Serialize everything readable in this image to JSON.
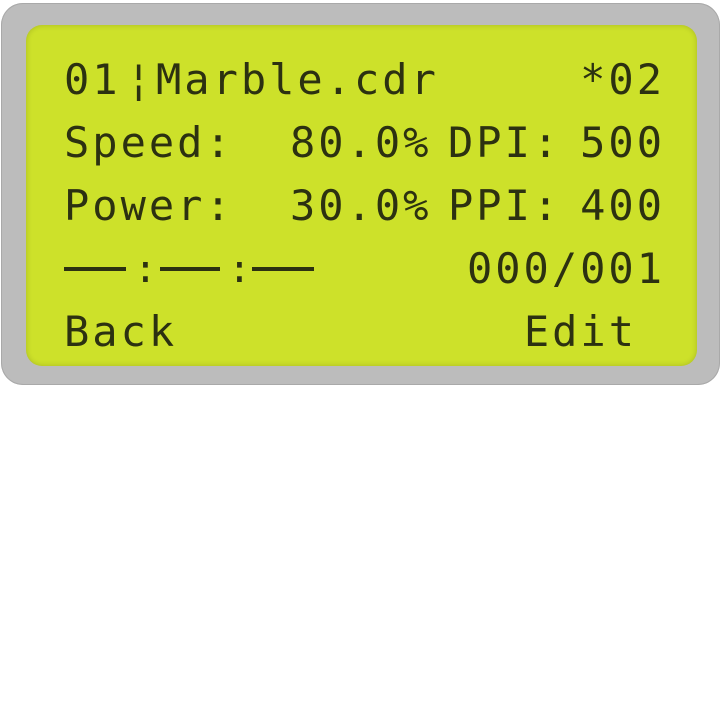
{
  "display": {
    "file_line": {
      "file_index": "01",
      "separator": "¦",
      "file_name": "Marble.cdr",
      "job_code": "*02"
    },
    "speed_line": {
      "label": "Speed:",
      "value": "80.0%",
      "dpi_label": "DPI:",
      "dpi_value": "500"
    },
    "power_line": {
      "label": "Power:",
      "value": "30.0%",
      "ppi_label": "PPI:",
      "ppi_value": "400"
    },
    "status_line": {
      "time_colon_1": ":",
      "time_colon_2": ":",
      "counter": "000/001"
    },
    "softkeys": {
      "left": "Back",
      "right": "Edit"
    }
  },
  "colors": {
    "lcd_background": "#cde12a",
    "lcd_text": "#2c3111",
    "bezel": "#bcbcbc"
  }
}
